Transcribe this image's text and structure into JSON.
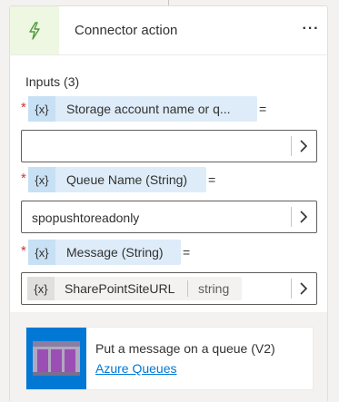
{
  "header": {
    "title": "Connector action",
    "icon": "lightning-bolt-icon",
    "more_label": "···",
    "accent_color": "#eef7e1"
  },
  "inputs": {
    "heading": "Inputs (3)",
    "token_icon_label": "{x}",
    "equals": "=",
    "params": [
      {
        "name": "Storage account name or q...",
        "required": true,
        "value": ""
      },
      {
        "name": "Queue Name (String)",
        "required": true,
        "value": "spopushtoreadonly"
      },
      {
        "name": "Message (String)",
        "required": true,
        "value_token": {
          "icon_label": "{x}",
          "name": "SharePointSiteURL",
          "type": "string"
        }
      }
    ]
  },
  "action": {
    "title": "Put a message on a queue (V2)",
    "link": "Azure Queues",
    "icon": "azure-queues-icon",
    "brand_color": "#0078d4"
  }
}
